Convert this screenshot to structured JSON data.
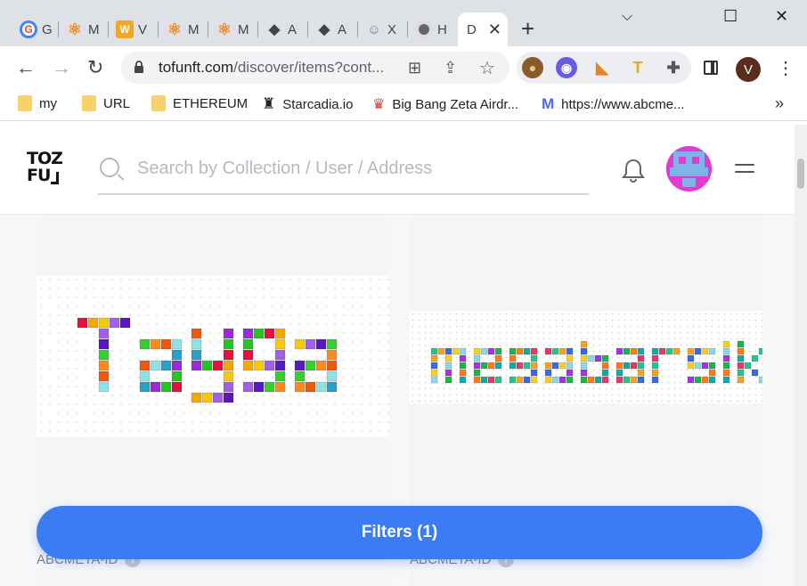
{
  "browser": {
    "tabs": [
      {
        "label": "G",
        "icon": "google-chrome-red-icon"
      },
      {
        "label": "M",
        "icon": "atom-orange-icon"
      },
      {
        "label": "V",
        "icon": "w-yellow-icon"
      },
      {
        "label": "M",
        "icon": "atom-orange-icon"
      },
      {
        "label": "M",
        "icon": "atom-orange-icon"
      },
      {
        "label": "A",
        "icon": "ethereum-icon"
      },
      {
        "label": "A",
        "icon": "ethereum-icon"
      },
      {
        "label": "X",
        "icon": "game-controller-icon"
      },
      {
        "label": "H",
        "icon": "chrome-icon"
      }
    ],
    "active_tab": {
      "label": "D",
      "close": "✕"
    },
    "new_tab": "+",
    "window": {
      "minimize": "⌵",
      "maximize": "☐",
      "close": "✕"
    },
    "url_host": "tofunft.com",
    "url_path": "/discover/items?cont...",
    "profile_initial": "V",
    "bookmarks": [
      {
        "label": "my",
        "icon": "folder-icon"
      },
      {
        "label": "URL",
        "icon": "folder-icon"
      },
      {
        "label": "ETHEREUM",
        "icon": "folder-icon"
      },
      {
        "label": "Starcadia.io",
        "icon": "starcadia-icon"
      },
      {
        "label": "Big Bang Zeta Airdr...",
        "icon": "bigbang-icon"
      },
      {
        "label": "https://www.abcme...",
        "icon": "gmail-icon"
      }
    ],
    "bookmarks_more": "»"
  },
  "site": {
    "logo_line1": "TOZ",
    "logo_line2": "FU",
    "search_placeholder": "Search by Collection / User / Address",
    "accent": "#3b7cf4"
  },
  "cards": [
    {
      "artwork_text": "Tayga",
      "owner": "ABCMETA-ID"
    },
    {
      "artwork_text": "megabarslk",
      "owner": "ABCMETA-ID"
    }
  ],
  "filters_button": "Filters (1)"
}
